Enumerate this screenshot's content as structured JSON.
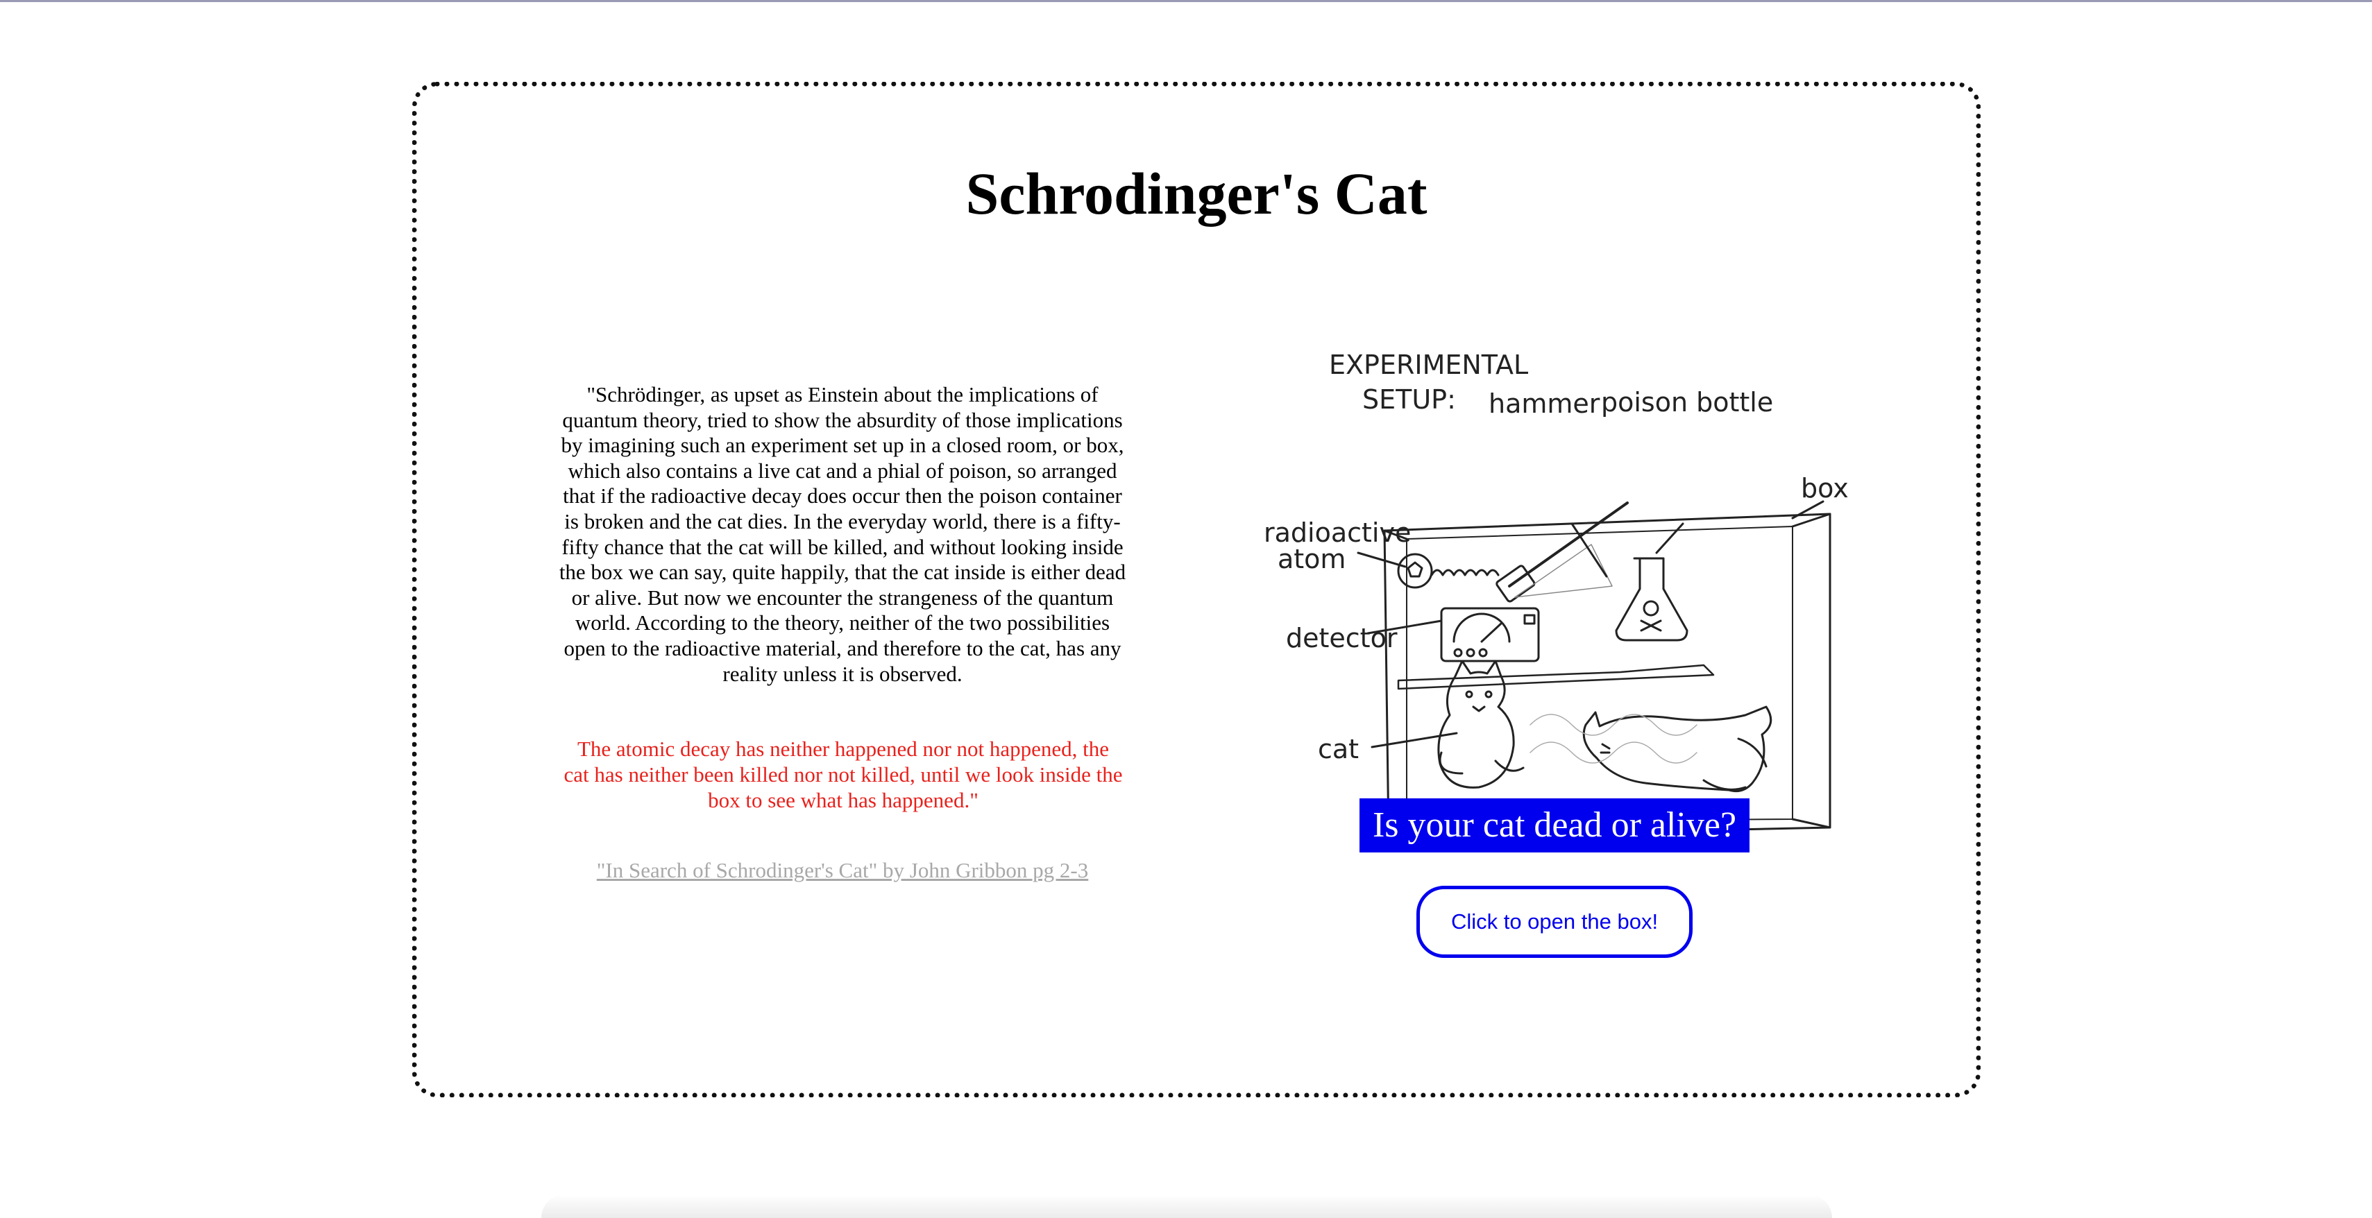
{
  "page": {
    "title": "Schrodinger's Cat"
  },
  "quote": {
    "main": "\"Schrödinger, as upset as Einstein about the implications of quantum theory, tried to show the absurdity of those implications by imagining such an experiment set up in a closed room, or box, which also contains a live cat and a phial of poison, so arranged that if the radioactive decay does occur then the poison container is broken and the cat dies. In the everyday world, there is a fifty-fifty chance that the cat will be killed, and without looking inside the box we can say, quite happily, that the cat inside is either dead or alive. But now we encounter the strangeness of the quantum world. According to the theory, neither of the two possibilities open to the radioactive material, and therefore to the cat, has any reality unless it is observed.",
    "highlight": "The atomic decay has neither happened nor not happened, the cat has neither been killed nor not killed, until we look inside the box to see what has happened.\"",
    "highlight_color": "#e8211c",
    "citation": "\"In Search of Schrodinger's Cat\" by John Gribbon pg 2-3"
  },
  "diagram": {
    "heading_line1": "EXPERIMENTAL",
    "heading_line2": "SETUP:",
    "labels": {
      "hammer": "hammer",
      "poison_bottle": "poison bottle",
      "box": "box",
      "radioactive": "radioactive",
      "atom": "atom",
      "detector": "detector",
      "cat": "cat"
    }
  },
  "prompt": {
    "banner": "Is your cat dead or alive?",
    "banner_color": "#0000ee",
    "button_label": "Click to open the box!"
  }
}
